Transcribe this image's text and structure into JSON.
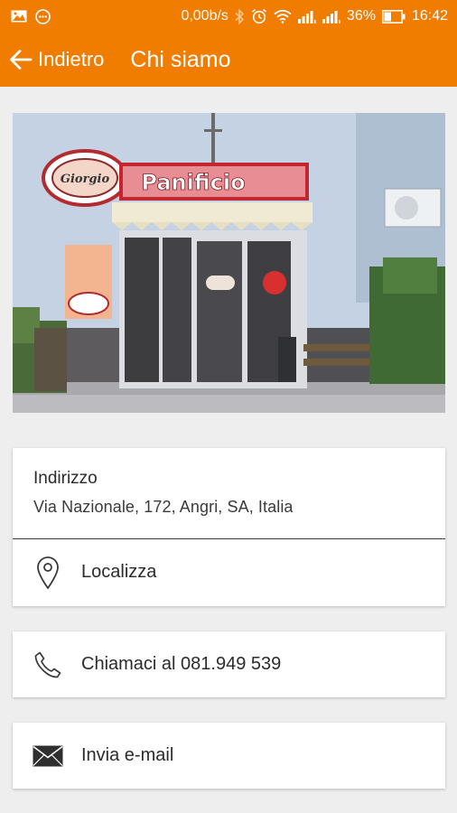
{
  "status_bar": {
    "network_speed": "0,00b/s",
    "battery": "36%",
    "time": "16:42"
  },
  "app_bar": {
    "back_label": "Indietro",
    "title": "Chi siamo"
  },
  "photo": {
    "shop_sign": "Panificio",
    "logo_script": "Giorgio"
  },
  "address": {
    "label": "Indirizzo",
    "value": "Via Nazionale, 172, Angri, SA, Italia"
  },
  "actions": {
    "locate": "Localizza",
    "call": "Chiamaci al 081.949 539",
    "email": "Invia e-mail"
  },
  "colors": {
    "accent": "#f07c00",
    "background": "#eeeeee",
    "card": "#ffffff"
  },
  "icons": {
    "back": "arrow-left-icon",
    "locate": "map-pin-icon",
    "call": "phone-icon",
    "email": "envelope-icon"
  }
}
